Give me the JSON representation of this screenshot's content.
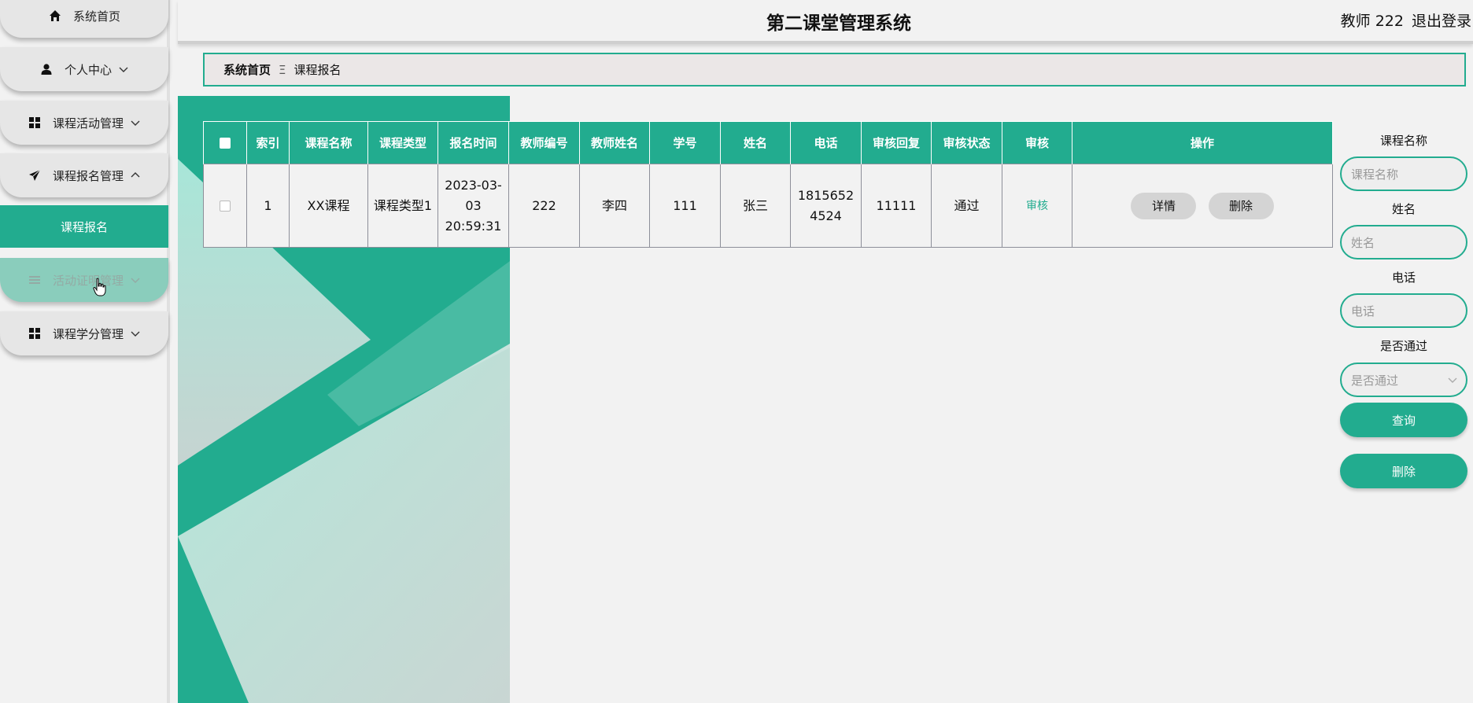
{
  "sidebar": {
    "items": [
      {
        "label": "系统首页",
        "icon": "home-icon",
        "chevron": ""
      },
      {
        "label": "个人中心",
        "icon": "user-icon",
        "chevron": "down"
      },
      {
        "label": "课程活动管理",
        "icon": "grid-icon",
        "chevron": "down"
      },
      {
        "label": "课程报名管理",
        "icon": "paper-plane-icon",
        "chevron": "up"
      },
      {
        "label": "活动证明管理",
        "icon": "list-icon",
        "chevron": "down"
      },
      {
        "label": "课程学分管理",
        "icon": "grid-icon",
        "chevron": "down"
      }
    ],
    "active_sub_item": "课程报名"
  },
  "header": {
    "title": "第二课堂管理系统",
    "user": "教师 222",
    "logout": "退出登录"
  },
  "breadcrumb": {
    "home": "系统首页",
    "separator": "Ξ",
    "current": "课程报名"
  },
  "table": {
    "columns": [
      "索引",
      "课程名称",
      "课程类型",
      "报名时间",
      "教师编号",
      "教师姓名",
      "学号",
      "姓名",
      "电话",
      "审核回复",
      "审核状态",
      "审核",
      "操作"
    ],
    "rows": [
      {
        "index": "1",
        "course_name": "XX课程",
        "course_type": "课程类型1",
        "signup_time": "2023-03-03 20:59:31",
        "teacher_no": "222",
        "teacher_name": "李四",
        "student_no": "111",
        "name": "张三",
        "phone": "18156524524",
        "audit_reply": "11111",
        "audit_status": "通过",
        "audit_action": "审核",
        "detail_label": "详情",
        "delete_label": "删除"
      }
    ]
  },
  "search": {
    "course_name_label": "课程名称",
    "course_name_placeholder": "课程名称",
    "name_label": "姓名",
    "name_placeholder": "姓名",
    "phone_label": "电话",
    "phone_placeholder": "电话",
    "pass_label": "是否通过",
    "pass_placeholder": "是否通过",
    "query_button": "查询",
    "delete_button": "删除"
  },
  "colors": {
    "accent": "#22ac8f",
    "deco_light": "#a8e6d8"
  }
}
